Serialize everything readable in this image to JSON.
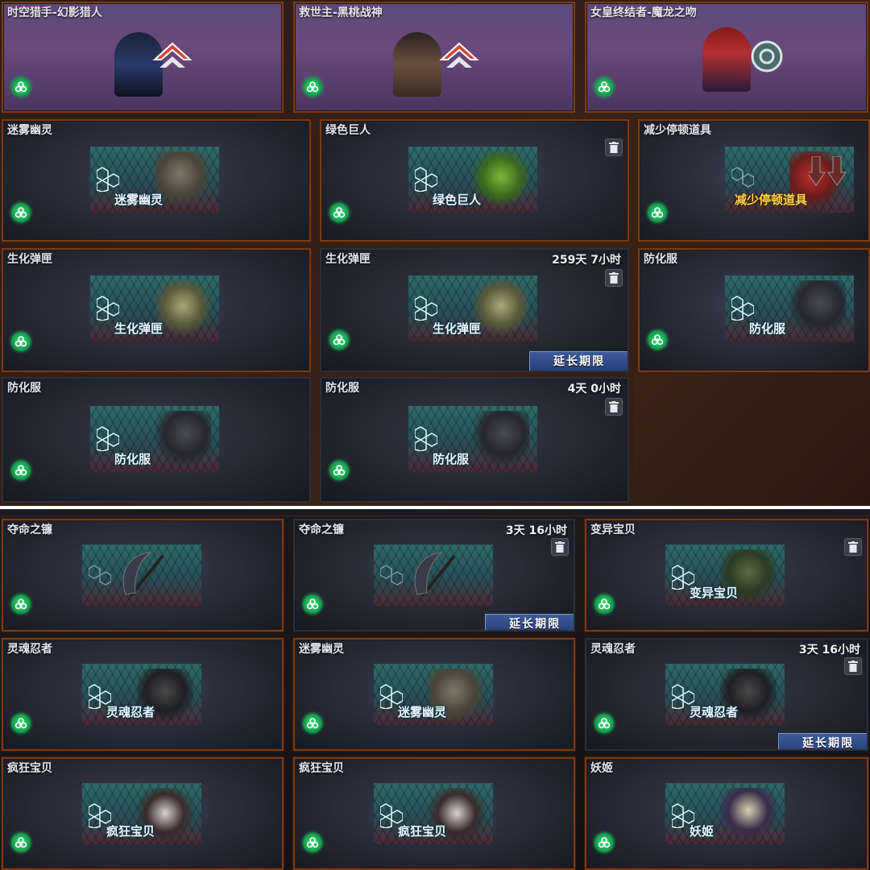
{
  "heroes": [
    {
      "title": "时空猎手-幻影猎人"
    },
    {
      "title": "救世主-黑桃战神"
    },
    {
      "title": "女皇终结者-魔龙之吻"
    }
  ],
  "top_grid": [
    {
      "title": "迷雾幽灵",
      "label": "迷雾幽灵"
    },
    {
      "title": "绿色巨人",
      "label": "绿色巨人"
    },
    {
      "title": "减少停顿道具",
      "label": "减少停顿道具"
    },
    {
      "title": "生化弹匣",
      "label": "生化弹匣"
    },
    {
      "title": "生化弹匣",
      "label": "生化弹匣",
      "timer": "259天 7小时"
    },
    {
      "title": "防化服",
      "label": "防化服"
    },
    {
      "title": "防化服",
      "label": "防化服"
    },
    {
      "title": "防化服",
      "label": "防化服",
      "timer": "4天 0小时"
    }
  ],
  "bottom_grid": [
    {
      "title": "夺命之镰",
      "label": ""
    },
    {
      "title": "夺命之镰",
      "label": "",
      "timer": "3天 16小时"
    },
    {
      "title": "变异宝贝",
      "label": "变异宝贝"
    },
    {
      "title": "灵魂忍者",
      "label": "灵魂忍者"
    },
    {
      "title": "迷雾幽灵",
      "label": "迷雾幽灵"
    },
    {
      "title": "灵魂忍者",
      "label": "灵魂忍者",
      "timer": "3天 16小时"
    },
    {
      "title": "疯狂宝贝",
      "label": "疯狂宝贝"
    },
    {
      "title": "疯狂宝贝",
      "label": "疯狂宝贝"
    },
    {
      "title": "妖姬",
      "label": "妖姬"
    }
  ],
  "buttons": {
    "extend": "延长期限"
  },
  "icons": {
    "bio": "biohazard-icon",
    "trash": "trash-icon"
  },
  "colors": {
    "card_border": "#7a3a14",
    "bio_green": "#15a04e",
    "button_blue": "#2c4a8a",
    "hero_purple": "#6a4a7c"
  }
}
